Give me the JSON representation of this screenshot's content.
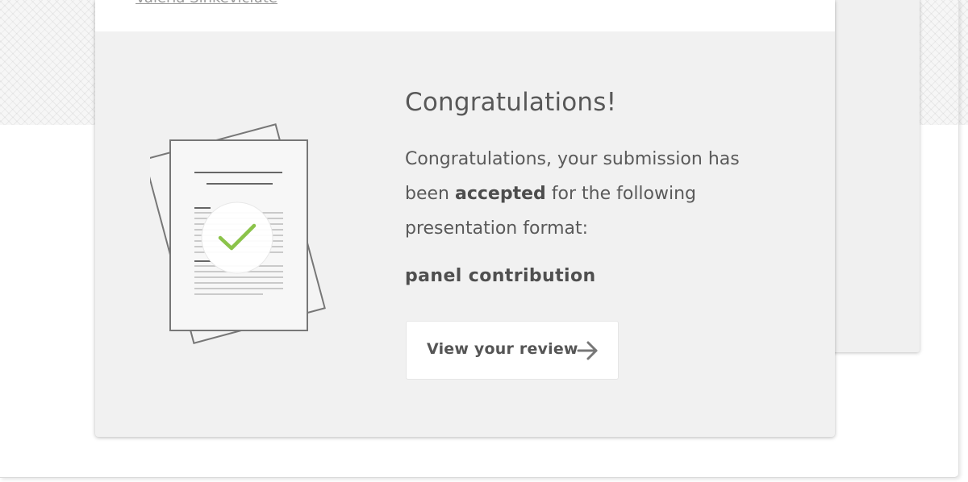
{
  "author": {
    "name": "Valeria Sinkeviciute"
  },
  "result": {
    "heading": "Congratulations!",
    "message_before": "Congratulations, your submission has been ",
    "status": "accepted",
    "message_after": " for the following presentation format:",
    "presentation_format": "panel contribution"
  },
  "actions": {
    "view_review_label": "View your review"
  },
  "icons": {
    "document": "accepted-document-icon",
    "check": "check-icon",
    "arrow": "arrow-right-icon"
  },
  "colors": {
    "check": "#8bc34a",
    "card_background": "#f1f1f1",
    "text": "#555555"
  }
}
